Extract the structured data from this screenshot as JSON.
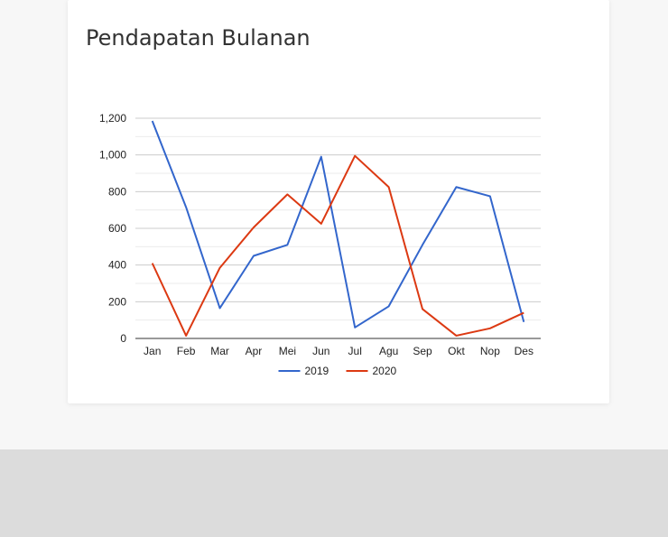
{
  "card": {
    "title": "Pendapatan Bulanan"
  },
  "chart_data": {
    "type": "line",
    "title": "Pendapatan Bulanan",
    "xlabel": "",
    "ylabel": "",
    "categories": [
      "Jan",
      "Feb",
      "Mar",
      "Apr",
      "Mei",
      "Jun",
      "Jul",
      "Agu",
      "Sep",
      "Okt",
      "Nop",
      "Des"
    ],
    "ylim": [
      0,
      1200
    ],
    "yticks": [
      0,
      200,
      400,
      600,
      800,
      1000,
      1200
    ],
    "ytick_labels": [
      "0",
      "200",
      "400",
      "600",
      "800",
      "1,000",
      "1,200"
    ],
    "grid": true,
    "legend_position": "bottom",
    "series": [
      {
        "name": "2019",
        "color": "#3366cc",
        "values": [
          1185,
          715,
          165,
          450,
          510,
          990,
          60,
          175,
          510,
          825,
          775,
          90
        ]
      },
      {
        "name": "2020",
        "color": "#dc3912",
        "values": [
          410,
          15,
          385,
          605,
          785,
          625,
          995,
          825,
          160,
          15,
          55,
          140
        ]
      }
    ]
  }
}
